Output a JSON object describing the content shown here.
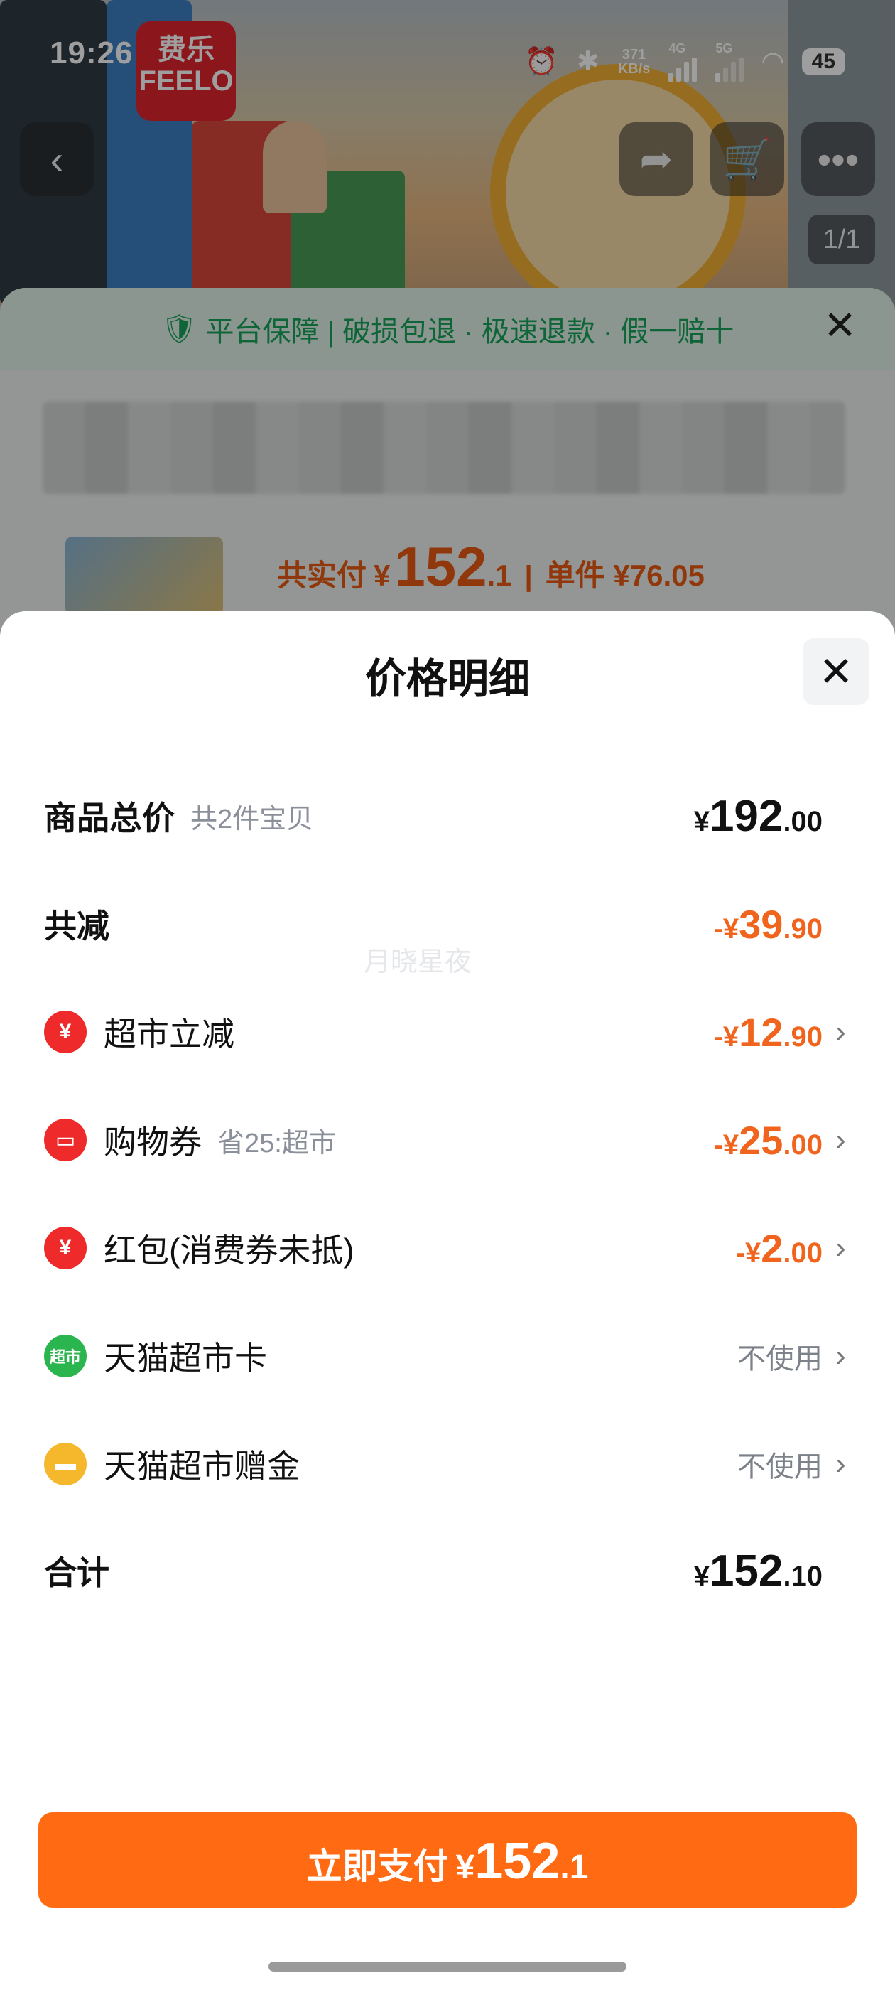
{
  "status_bar": {
    "time": "19:26",
    "network_speed_top": "371",
    "network_speed_unit": "KB/s",
    "signal1": "4G",
    "signal2": "5G",
    "battery": "45"
  },
  "brand_logo": {
    "line1": "费乐",
    "line2": "FEELO"
  },
  "background": {
    "image_counter": "1/1",
    "guarantee_text": "平台保障 | 破损包退 · 极速退款 · 假一赔十",
    "pay_prefix": "共实付",
    "pay_currency": "¥",
    "pay_int": "152",
    "pay_dec": ".1",
    "unit_price": "单件 ¥76.05"
  },
  "modal": {
    "title": "价格明细",
    "watermark": "月晓星夜",
    "rows": {
      "total_goods": {
        "label": "商品总价",
        "sub": "共2件宝贝",
        "currency": "¥",
        "int": "192",
        "dec": ".00"
      },
      "total_discount": {
        "label": "共减",
        "currency": "-¥",
        "int": "39",
        "dec": ".90"
      },
      "supermarket_cut": {
        "label": "超市立减",
        "currency": "-¥",
        "int": "12",
        "dec": ".90"
      },
      "shopping_coupon": {
        "label": "购物券",
        "sub": "省25:超市",
        "currency": "-¥",
        "int": "25",
        "dec": ".00"
      },
      "red_packet": {
        "label": "红包(消费券未抵)",
        "currency": "-¥",
        "int": "2",
        "dec": ".00"
      },
      "tmall_card": {
        "label": "天猫超市卡",
        "status": "不使用",
        "icon_text": "超市"
      },
      "tmall_gift": {
        "label": "天猫超市赠金",
        "status": "不使用"
      },
      "grand_total": {
        "label": "合计",
        "currency": "¥",
        "int": "152",
        "dec": ".10"
      }
    },
    "pay_button": {
      "label": "立即支付",
      "currency": "¥",
      "int": "152",
      "dec": ".1"
    }
  },
  "colors": {
    "accent": "#ff6a12",
    "discount": "#f0641e",
    "guarantee": "#17a35a"
  }
}
